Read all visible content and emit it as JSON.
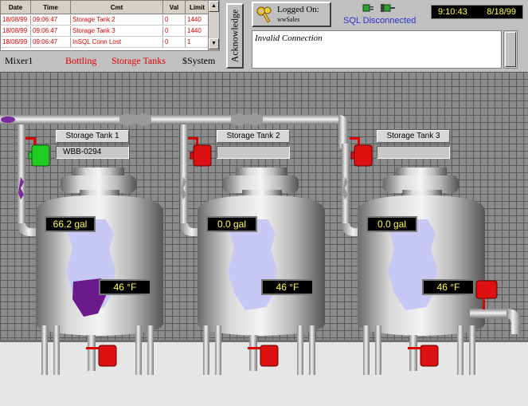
{
  "alarm_table": {
    "columns": [
      "Date",
      "Time",
      "Cmt",
      "Val",
      "Limit"
    ],
    "rows": [
      [
        "18/08/99",
        "09:06:47",
        "Storage Tank 2",
        "0",
        "1440"
      ],
      [
        "18/08/99",
        "09:06:47",
        "Storage Tank 3",
        "0",
        "1440"
      ],
      [
        "18/08/99",
        "09:06:47",
        "InSQL Conn Lost",
        "0",
        "1"
      ]
    ],
    "scroll_up": "▲",
    "scroll_down": "▼"
  },
  "filters": {
    "mixer": "Mixer1",
    "bottling": "Bottling",
    "storage": "Storage Tanks",
    "system": "$System"
  },
  "acknowledge_label": "Acknowledge",
  "logged_on": {
    "title": "Logged On:",
    "user": "wwSales"
  },
  "sql_status": "SQL Disconnected",
  "clock": {
    "time": "9:10:43",
    "date": "8/18/99"
  },
  "message": "Invalid Connection",
  "tanks": [
    {
      "label": "Storage Tank 1",
      "batch": "WBB-0294",
      "volume": "66.2 gal",
      "temp": "46 °F",
      "valve_state": "open"
    },
    {
      "label": "Storage Tank 2",
      "batch": "",
      "volume": "0.0 gal",
      "temp": "46 °F",
      "valve_state": "closed"
    },
    {
      "label": "Storage Tank 3",
      "batch": "",
      "volume": "0.0 gal",
      "temp": "46 °F",
      "valve_state": "closed"
    }
  ],
  "colors": {
    "alarm_text": "#e00000",
    "lcd_text": "#ffff3c",
    "sql_text": "#2a33c8",
    "valve_open": "#22cc22",
    "valve_closed": "#dd1111",
    "product": "#6a1a8a",
    "liquid_ice": "#c8c8f5"
  }
}
